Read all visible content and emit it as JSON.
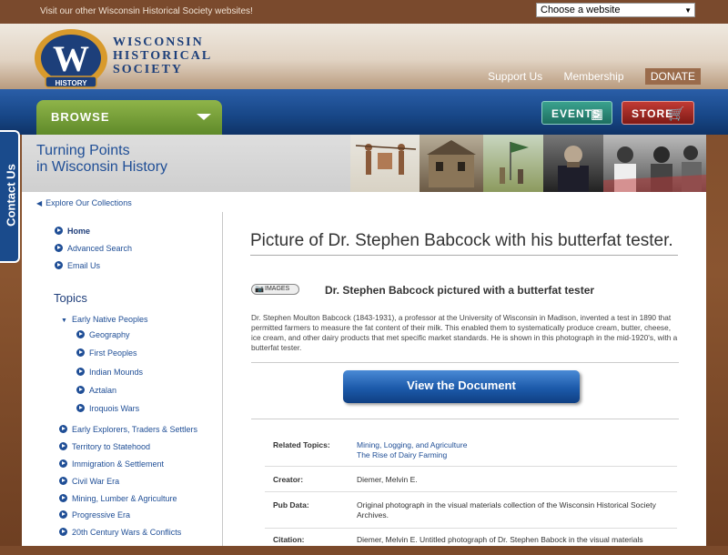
{
  "topbar": {
    "visit_text": "Visit our other Wisconsin Historical Society websites!",
    "website_select": "Choose a website"
  },
  "logo": {
    "letter": "W",
    "badge_text": "HISTORY",
    "line1": "WISCONSIN",
    "line2": "HISTORICAL",
    "line3": "SOCIETY"
  },
  "toplinks": [
    "Support Us",
    "Membership",
    "DONATE"
  ],
  "nav": {
    "browse": "BROWSE",
    "events": "EVENTS",
    "store": "STORE"
  },
  "contact_tab": "Contact Us",
  "banner": {
    "line1": "Turning Points",
    "line2": "in Wisconsin History"
  },
  "sidebar": {
    "explore": "Explore Our Collections",
    "links": [
      "Home",
      "Advanced Search",
      "Email Us"
    ],
    "topics_heading": "Topics",
    "topics": [
      {
        "label": "Early Native Peoples",
        "expanded": true
      },
      {
        "label": "Geography",
        "sub": true
      },
      {
        "label": "First Peoples",
        "sub": true
      },
      {
        "label": "Indian Mounds",
        "sub": true
      },
      {
        "label": "Aztalan",
        "sub": true
      },
      {
        "label": "Iroquois Wars",
        "sub": true
      },
      {
        "label": "Early Explorers, Traders & Settlers"
      },
      {
        "label": "Territory to Statehood"
      },
      {
        "label": "Immigration & Settlement"
      },
      {
        "label": "Civil War Era"
      },
      {
        "label": "Mining, Lumber & Agriculture"
      },
      {
        "label": "Progressive Era"
      },
      {
        "label": "20th Century Wars & Conflicts"
      }
    ]
  },
  "main": {
    "title": "Picture of Dr. Stephen Babcock with his butterfat tester.",
    "badge": "IMAGES",
    "subtitle": "Dr. Stephen Babcock pictured with a butterfat tester",
    "description": "Dr. Stephen Moulton Babcock (1843-1931), a professor at the University of Wisconsin in Madison, invented a test in 1890 that permitted farmers to measure the fat content of their milk. This enabled them to systematically produce cream, butter, cheese, ice cream, and other dairy products that met specific market standards. He is shown in this photograph in the mid-1920's, with a butterfat tester.",
    "view_button": "View the Document",
    "meta": {
      "related_label": "Related Topics:",
      "related": [
        "Mining, Logging, and Agriculture",
        "The Rise of Dairy Farming"
      ],
      "creator_label": "Creator:",
      "creator": "Diemer, Melvin E.",
      "pubdata_label": "Pub Data:",
      "pubdata": "Original photograph in the visual materials collection of the Wisconsin Historical Society Archives.",
      "citation_label": "Citation:",
      "citation": "Diemer, Melvin E. Untitled photograph of Dr. Stephen Babock in the visual materials"
    }
  },
  "colors": {
    "brand_blue": "#1f4e96",
    "nav_blue": "#174686",
    "browse_green": "#6f9a33",
    "events_teal": "#2a8a78",
    "store_red": "#a0282a",
    "background_brown": "#7b4a2b"
  }
}
